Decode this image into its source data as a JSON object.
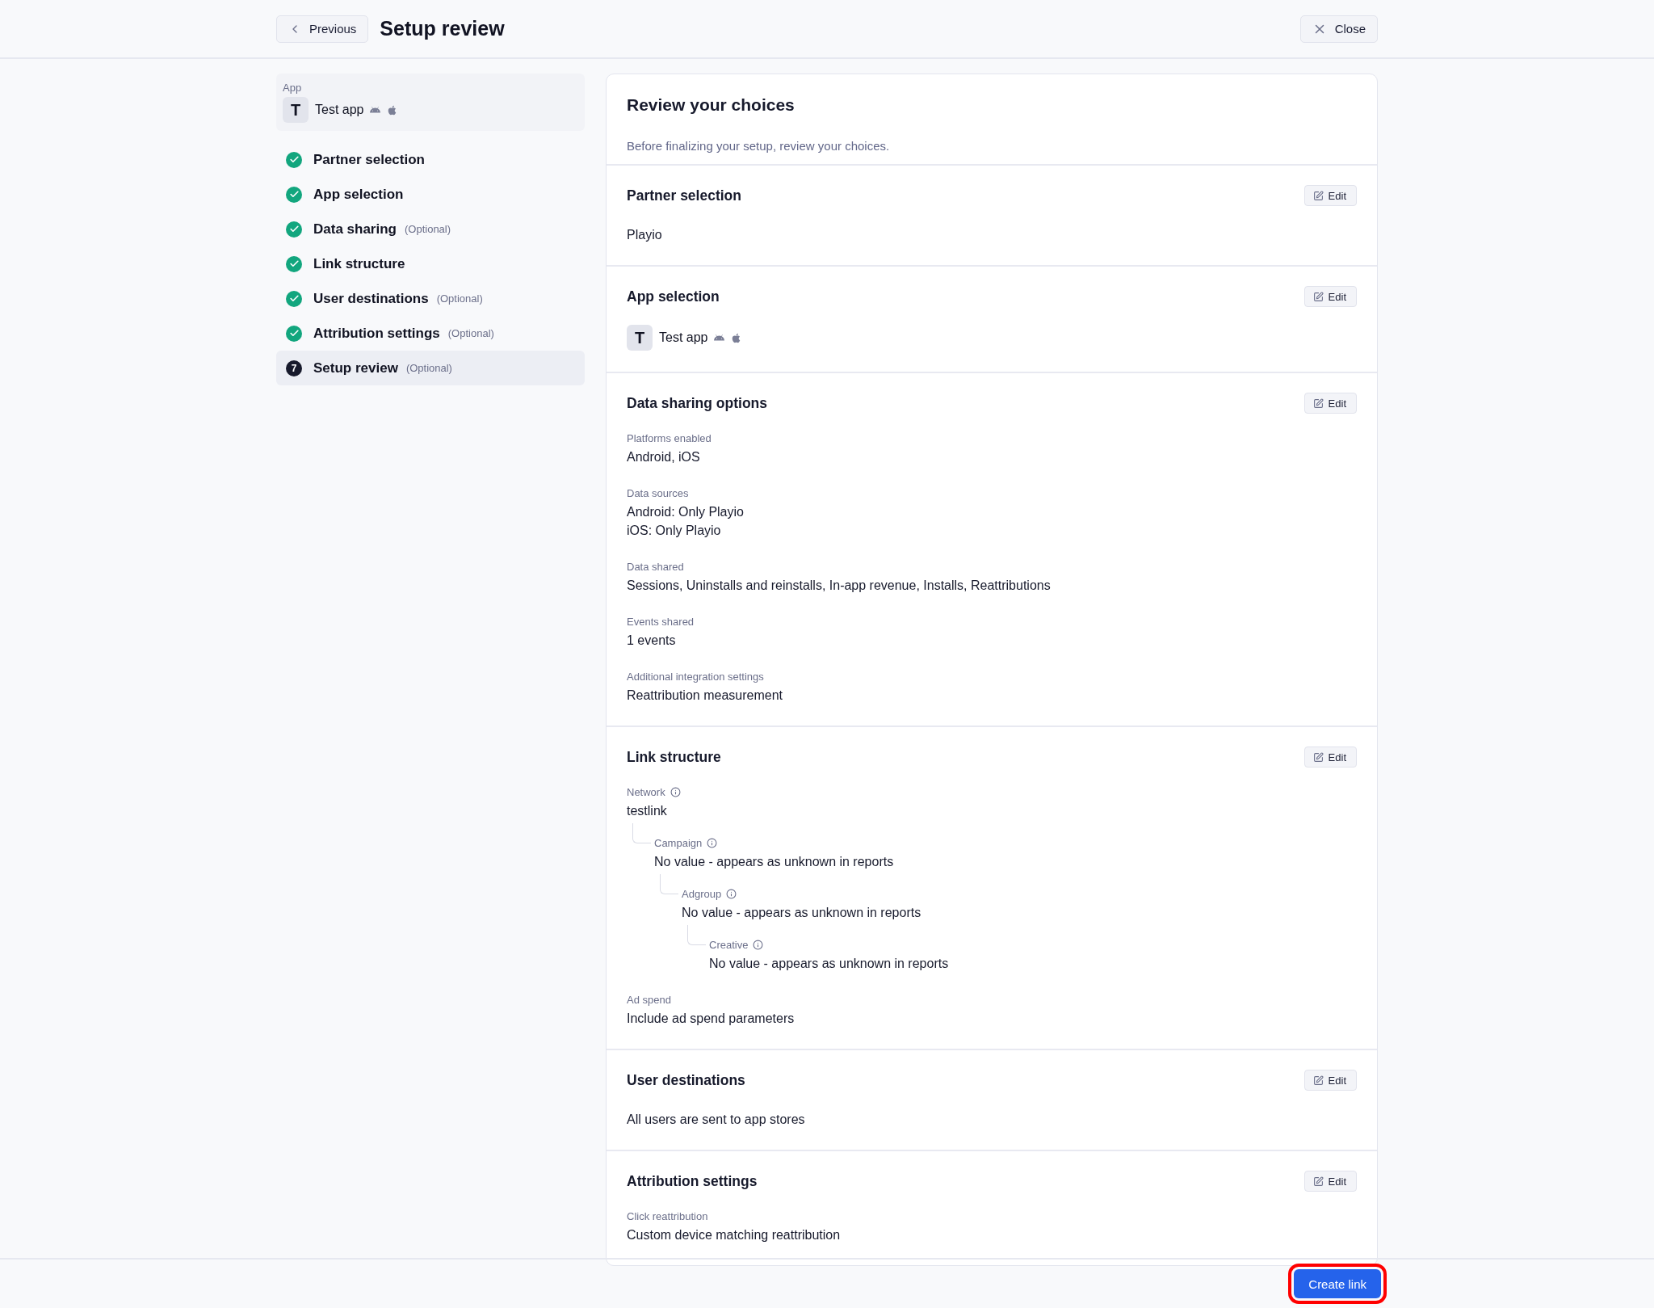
{
  "header": {
    "back_button": "Previous",
    "title": "Setup review",
    "close_button": "Close"
  },
  "sidebar": {
    "app": {
      "label": "App",
      "initial": "T",
      "name": "Test app",
      "android": true,
      "ios": true
    },
    "steps": [
      {
        "label": "Partner selection",
        "completed": true,
        "selected": false
      },
      {
        "label": "App selection",
        "completed": true,
        "selected": false
      },
      {
        "label": "Data sharing",
        "optional": "(Optional)",
        "completed": true,
        "selected": false
      },
      {
        "label": "Link structure",
        "completed": true,
        "selected": false
      },
      {
        "label": "User destinations",
        "optional": "(Optional)",
        "completed": true,
        "selected": false
      },
      {
        "label": "Attribution settings",
        "optional": "(Optional)",
        "completed": true,
        "selected": false
      },
      {
        "label": "Setup review",
        "optional": "(Optional)",
        "completed": false,
        "number": "7",
        "selected": true
      }
    ]
  },
  "review": {
    "title": "Review your choices",
    "subtitle": "Before finalizing your setup, review your choices.",
    "sections": [
      {
        "kind": "text",
        "title": "Partner selection",
        "edit": "Edit",
        "value": "Playio"
      },
      {
        "kind": "app",
        "title": "App selection",
        "edit": "Edit",
        "app": {
          "initial": "T",
          "name": "Test app",
          "android": true,
          "ios": true
        }
      },
      {
        "kind": "fields",
        "title": "Data sharing options",
        "edit": "Edit",
        "fields": [
          {
            "label": "Platforms enabled",
            "lines": [
              "Android, iOS"
            ]
          },
          {
            "label": "Data sources",
            "lines": [
              "Android: Only Playio",
              "iOS: Only Playio"
            ]
          },
          {
            "label": "Data shared",
            "lines": [
              "Sessions, Uninstalls and reinstalls, In-app revenue, Installs, Reattributions"
            ]
          },
          {
            "label": "Events shared",
            "lines": [
              "1 events"
            ]
          },
          {
            "label": "Additional integration settings",
            "lines": [
              "Reattribution measurement"
            ]
          }
        ]
      },
      {
        "kind": "fields",
        "title": "Link structure",
        "edit": "Edit",
        "fields": [
          {
            "label": "Network",
            "info": true,
            "lines": [
              "testlink"
            ],
            "children": [
              {
                "label": "Campaign",
                "info": true,
                "lines": [
                  "No value - appears as unknown in reports"
                ],
                "children": [
                  {
                    "label": "Adgroup",
                    "info": true,
                    "lines": [
                      "No value - appears as unknown in reports"
                    ],
                    "children": [
                      {
                        "label": "Creative",
                        "info": true,
                        "lines": [
                          "No value - appears as unknown in reports"
                        ]
                      }
                    ]
                  }
                ]
              }
            ]
          },
          {
            "label": "Ad spend",
            "lines": [
              "Include ad spend parameters"
            ]
          }
        ]
      },
      {
        "kind": "text",
        "title": "User destinations",
        "edit": "Edit",
        "value": "All users are sent to app stores"
      },
      {
        "kind": "fields",
        "title": "Attribution settings",
        "edit": "Edit",
        "fields": [
          {
            "label": "Click reattribution",
            "lines": [
              "Custom device matching reattribution"
            ]
          }
        ]
      }
    ]
  },
  "footer": {
    "primary_button": "Create link",
    "highlighted": true
  }
}
